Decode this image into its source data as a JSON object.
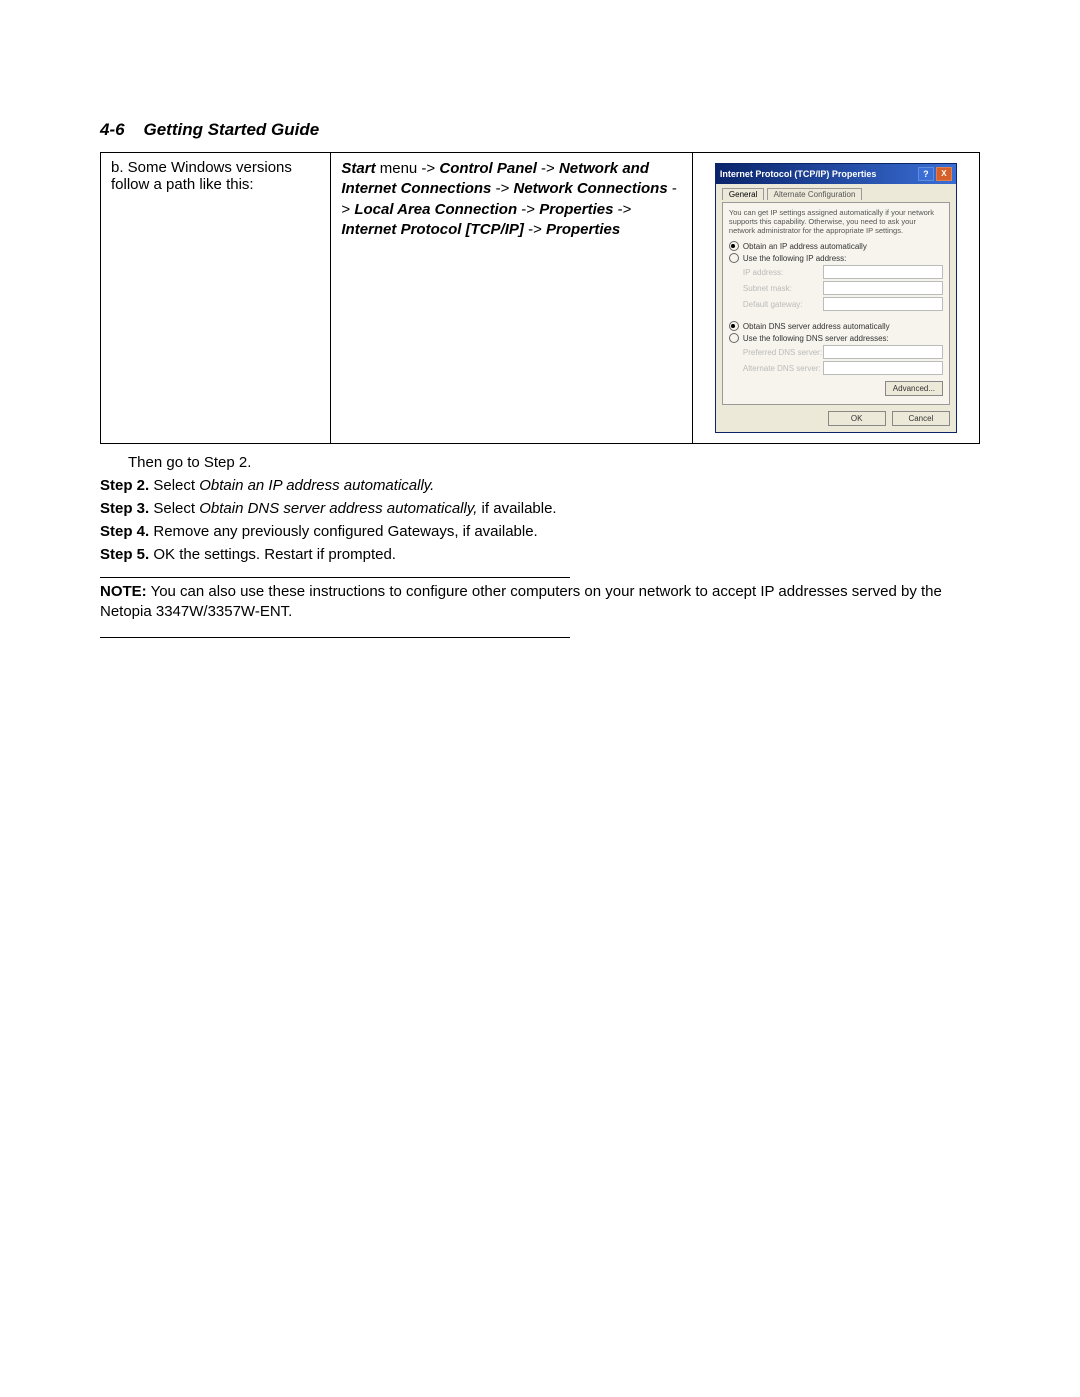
{
  "header": {
    "page_num": "4-6",
    "title": "Getting Started Guide"
  },
  "table": {
    "left_cell": "b. Some Windows versions follow a path like this:",
    "mid": {
      "p1_b": "Start",
      "p1_t": " menu -> ",
      "p2_b": "Control Panel",
      "p2_t": " -> ",
      "p3_b": "Network and Internet Connections",
      "p3_t": " -> ",
      "p4_b": "Network Connections",
      "p4_t": " -> ",
      "p5_b": "Local Area Connection",
      "p5_t": " -> ",
      "p6_b": "Properties",
      "p6_t": " -> ",
      "p7_b": "Internet Protocol [TCP/IP]",
      "p7_t": " -> ",
      "p8_b": "Properties"
    }
  },
  "dialog": {
    "title": "Internet Protocol (TCP/IP) Properties",
    "help": "?",
    "close": "X",
    "tab_general": "General",
    "tab_alt": "Alternate Configuration",
    "desc": "You can get IP settings assigned automatically if your network supports this capability. Otherwise, you need to ask your network administrator for the appropriate IP settings.",
    "radio_ip_auto": "Obtain an IP address automatically",
    "radio_ip_manual": "Use the following IP address:",
    "fld_ip": "IP address:",
    "fld_subnet": "Subnet mask:",
    "fld_gateway": "Default gateway:",
    "radio_dns_auto": "Obtain DNS server address automatically",
    "radio_dns_manual": "Use the following DNS server addresses:",
    "fld_dns1": "Preferred DNS server:",
    "fld_dns2": "Alternate DNS server:",
    "btn_adv": "Advanced...",
    "btn_ok": "OK",
    "btn_cancel": "Cancel"
  },
  "post_table_line": "Then go to Step 2.",
  "steps": {
    "s2_label": "Step 2.",
    "s2_a": " Select ",
    "s2_it": "Obtain an IP address automatically.",
    "s3_label": "Step 3.",
    "s3_a": " Select ",
    "s3_it": "Obtain DNS server address automatically,",
    "s3_b": " if available.",
    "s4_label": "Step 4.",
    "s4_a": " Remove any previously configured Gateways, if available.",
    "s5_label": "Step 5.",
    "s5_a": " OK the settings. Restart if prompted."
  },
  "note": {
    "label": "NOTE:",
    "text": " You can also use these instructions to configure other computers on your network to accept IP addresses served by the Netopia 3347W/3357W-ENT."
  }
}
